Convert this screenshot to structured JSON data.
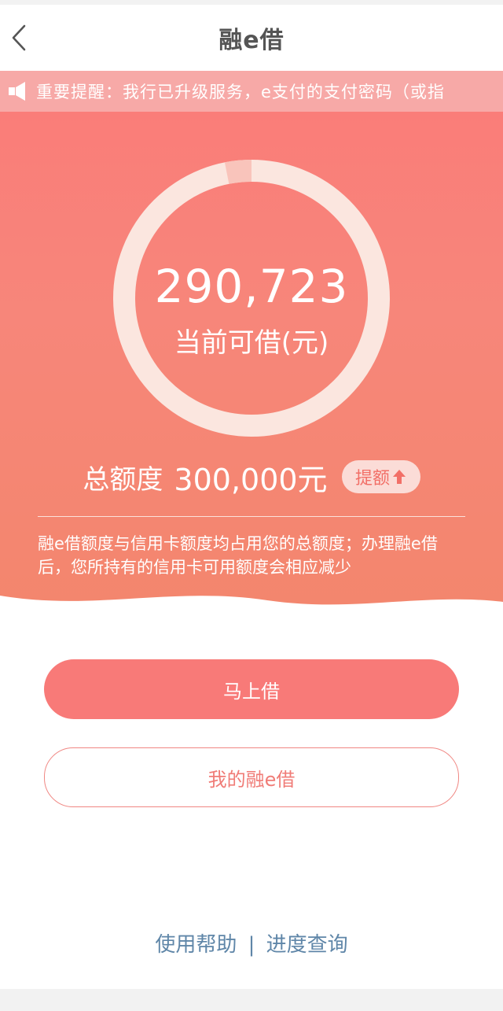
{
  "navbar": {
    "title": "融e借",
    "back_icon": "chevron-left-icon"
  },
  "notice": {
    "icon": "speaker-icon",
    "text": "重要提醒：我行已升级服务，e支付的支付密码（或指"
  },
  "credit": {
    "available_amount": "290,723",
    "available_label": "当前可借(元)",
    "used_fraction": 0.031,
    "total_label": "总额度",
    "total_value": "300,000元",
    "raise_label": "提额",
    "raise_icon": "arrow-up-icon",
    "description": "融e借额度与信用卡额度均占用您的总额度；办理融e借后，您所持有的信用卡可用额度会相应减少"
  },
  "actions": {
    "borrow_now": "马上借",
    "my_loans": "我的融e借"
  },
  "footer": {
    "help": "使用帮助",
    "separator": "|",
    "progress": "进度查询"
  },
  "colors": {
    "brand": "#f87a78",
    "notice_bg": "#f7a9a7",
    "link": "#5f86a8"
  }
}
